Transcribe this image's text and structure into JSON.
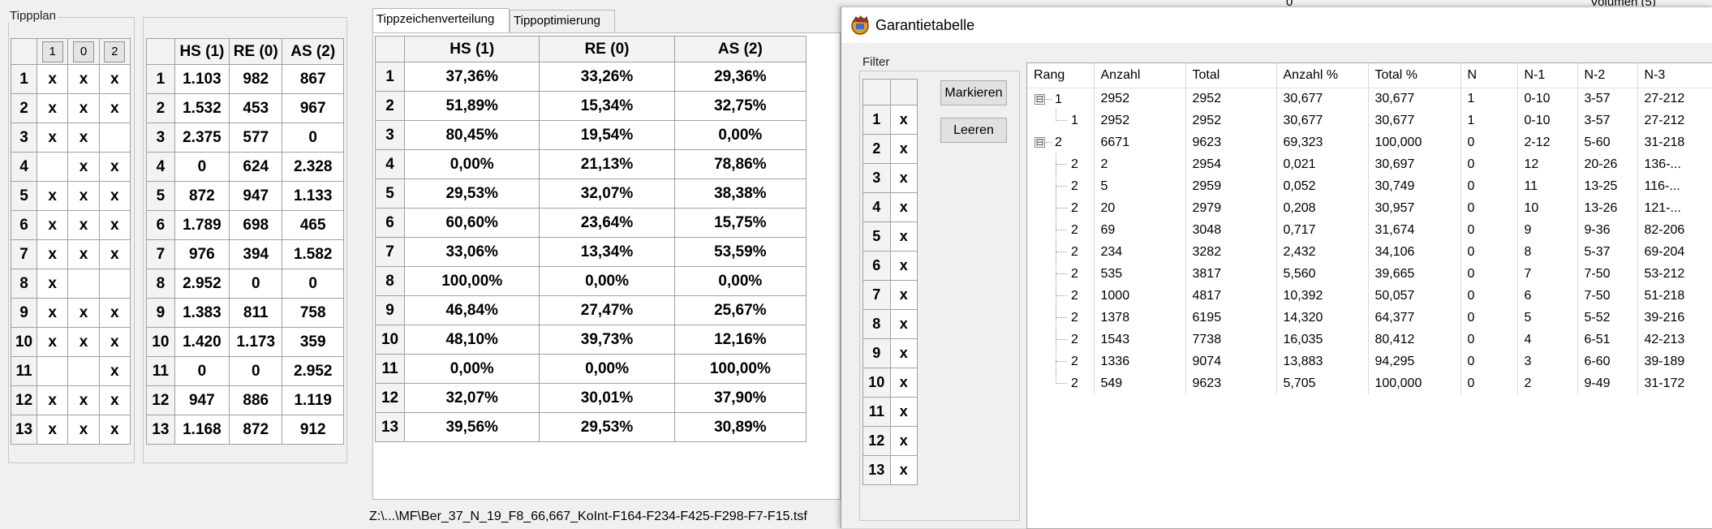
{
  "tippplan": {
    "title": "Tippplan",
    "header_buttons": [
      "1",
      "0",
      "2"
    ],
    "rows": [
      {
        "n": "1",
        "c1": "x",
        "c0": "x",
        "c2": "x"
      },
      {
        "n": "2",
        "c1": "x",
        "c0": "x",
        "c2": "x"
      },
      {
        "n": "3",
        "c1": "x",
        "c0": "x",
        "c2": ""
      },
      {
        "n": "4",
        "c1": "",
        "c0": "x",
        "c2": "x"
      },
      {
        "n": "5",
        "c1": "x",
        "c0": "x",
        "c2": "x"
      },
      {
        "n": "6",
        "c1": "x",
        "c0": "x",
        "c2": "x"
      },
      {
        "n": "7",
        "c1": "x",
        "c0": "x",
        "c2": "x"
      },
      {
        "n": "8",
        "c1": "x",
        "c0": "",
        "c2": ""
      },
      {
        "n": "9",
        "c1": "x",
        "c0": "x",
        "c2": "x"
      },
      {
        "n": "10",
        "c1": "x",
        "c0": "x",
        "c2": "x"
      },
      {
        "n": "11",
        "c1": "",
        "c0": "",
        "c2": "x"
      },
      {
        "n": "12",
        "c1": "x",
        "c0": "x",
        "c2": "x"
      },
      {
        "n": "13",
        "c1": "x",
        "c0": "x",
        "c2": "x"
      }
    ]
  },
  "counts": {
    "headers": [
      "HS (1)",
      "RE (0)",
      "AS (2)"
    ],
    "rows": [
      [
        "1",
        "1.103",
        "982",
        "867"
      ],
      [
        "2",
        "1.532",
        "453",
        "967"
      ],
      [
        "3",
        "2.375",
        "577",
        "0"
      ],
      [
        "4",
        "0",
        "624",
        "2.328"
      ],
      [
        "5",
        "872",
        "947",
        "1.133"
      ],
      [
        "6",
        "1.789",
        "698",
        "465"
      ],
      [
        "7",
        "976",
        "394",
        "1.582"
      ],
      [
        "8",
        "2.952",
        "0",
        "0"
      ],
      [
        "9",
        "1.383",
        "811",
        "758"
      ],
      [
        "10",
        "1.420",
        "1.173",
        "359"
      ],
      [
        "11",
        "0",
        "0",
        "2.952"
      ],
      [
        "12",
        "947",
        "886",
        "1.119"
      ],
      [
        "13",
        "1.168",
        "872",
        "912"
      ]
    ]
  },
  "tabs": [
    "Tippzeichenverteilung",
    "Tippoptimierung"
  ],
  "distribution": {
    "headers": [
      "HS (1)",
      "RE (0)",
      "AS (2)"
    ],
    "rows": [
      [
        "1",
        "37,36%",
        "33,26%",
        "29,36%"
      ],
      [
        "2",
        "51,89%",
        "15,34%",
        "32,75%"
      ],
      [
        "3",
        "80,45%",
        "19,54%",
        "0,00%"
      ],
      [
        "4",
        "0,00%",
        "21,13%",
        "78,86%"
      ],
      [
        "5",
        "29,53%",
        "32,07%",
        "38,38%"
      ],
      [
        "6",
        "60,60%",
        "23,64%",
        "15,75%"
      ],
      [
        "7",
        "33,06%",
        "13,34%",
        "53,59%"
      ],
      [
        "8",
        "100,00%",
        "0,00%",
        "0,00%"
      ],
      [
        "9",
        "46,84%",
        "27,47%",
        "25,67%"
      ],
      [
        "10",
        "48,10%",
        "39,73%",
        "12,16%"
      ],
      [
        "11",
        "0,00%",
        "0,00%",
        "100,00%"
      ],
      [
        "12",
        "32,07%",
        "30,01%",
        "37,90%"
      ],
      [
        "13",
        "39,56%",
        "29,53%",
        "30,89%"
      ]
    ]
  },
  "status_path": "Z:\\...\\MF\\Ber_37_N_19_F8_66,667_KoInt-F164-F234-F425-F298-F7-F15.tsf",
  "window": {
    "title": "Garantietabelle",
    "icon": "app-icon",
    "filter": {
      "title": "Filter",
      "rows": [
        [
          "1",
          "x"
        ],
        [
          "2",
          "x"
        ],
        [
          "3",
          "x"
        ],
        [
          "4",
          "x"
        ],
        [
          "5",
          "x"
        ],
        [
          "6",
          "x"
        ],
        [
          "7",
          "x"
        ],
        [
          "8",
          "x"
        ],
        [
          "9",
          "x"
        ],
        [
          "10",
          "x"
        ],
        [
          "11",
          "x"
        ],
        [
          "12",
          "x"
        ],
        [
          "13",
          "x"
        ]
      ]
    },
    "buttons": {
      "mark": "Markieren",
      "clear": "Leeren"
    },
    "table": {
      "columns": [
        "Rang",
        "Anzahl",
        "Total",
        "Anzahl %",
        "Total %",
        "N",
        "N-1",
        "N-2",
        "N-3"
      ],
      "rows": [
        {
          "level": 0,
          "expander": "⊟",
          "rang": "1",
          "cells": [
            "2952",
            "2952",
            "30,677",
            "30,677",
            "1",
            "0-10",
            "3-57",
            "27-212"
          ]
        },
        {
          "level": 1,
          "expander": "",
          "rang": "1",
          "cells": [
            "2952",
            "2952",
            "30,677",
            "30,677",
            "1",
            "0-10",
            "3-57",
            "27-212"
          ]
        },
        {
          "level": 0,
          "expander": "⊟",
          "rang": "2",
          "cells": [
            "6671",
            "9623",
            "69,323",
            "100,000",
            "0",
            "2-12",
            "5-60",
            "31-218"
          ]
        },
        {
          "level": 1,
          "expander": "",
          "rang": "2",
          "cells": [
            "2",
            "2954",
            "0,021",
            "30,697",
            "0",
            "12",
            "20-26",
            "136-..."
          ]
        },
        {
          "level": 1,
          "expander": "",
          "rang": "2",
          "cells": [
            "5",
            "2959",
            "0,052",
            "30,749",
            "0",
            "11",
            "13-25",
            "116-..."
          ]
        },
        {
          "level": 1,
          "expander": "",
          "rang": "2",
          "cells": [
            "20",
            "2979",
            "0,208",
            "30,957",
            "0",
            "10",
            "13-26",
            "121-..."
          ]
        },
        {
          "level": 1,
          "expander": "",
          "rang": "2",
          "cells": [
            "69",
            "3048",
            "0,717",
            "31,674",
            "0",
            "9",
            "9-36",
            "82-206"
          ]
        },
        {
          "level": 1,
          "expander": "",
          "rang": "2",
          "cells": [
            "234",
            "3282",
            "2,432",
            "34,106",
            "0",
            "8",
            "5-37",
            "69-204"
          ]
        },
        {
          "level": 1,
          "expander": "",
          "rang": "2",
          "cells": [
            "535",
            "3817",
            "5,560",
            "39,665",
            "0",
            "7",
            "7-50",
            "53-212"
          ]
        },
        {
          "level": 1,
          "expander": "",
          "rang": "2",
          "cells": [
            "1000",
            "4817",
            "10,392",
            "50,057",
            "0",
            "6",
            "7-50",
            "51-218"
          ]
        },
        {
          "level": 1,
          "expander": "",
          "rang": "2",
          "cells": [
            "1378",
            "6195",
            "14,320",
            "64,377",
            "0",
            "5",
            "5-52",
            "39-216"
          ]
        },
        {
          "level": 1,
          "expander": "",
          "rang": "2",
          "cells": [
            "1543",
            "7738",
            "16,035",
            "80,412",
            "0",
            "4",
            "6-51",
            "42-213"
          ]
        },
        {
          "level": 1,
          "expander": "",
          "rang": "2",
          "cells": [
            "1336",
            "9074",
            "13,883",
            "94,295",
            "0",
            "3",
            "6-60",
            "39-189"
          ]
        },
        {
          "level": 1,
          "expander": "",
          "rang": "2",
          "cells": [
            "549",
            "9623",
            "5,705",
            "100,000",
            "0",
            "2",
            "9-49",
            "31-172"
          ]
        }
      ]
    }
  },
  "background_fragments": [
    "0",
    "Volumen (5)"
  ]
}
